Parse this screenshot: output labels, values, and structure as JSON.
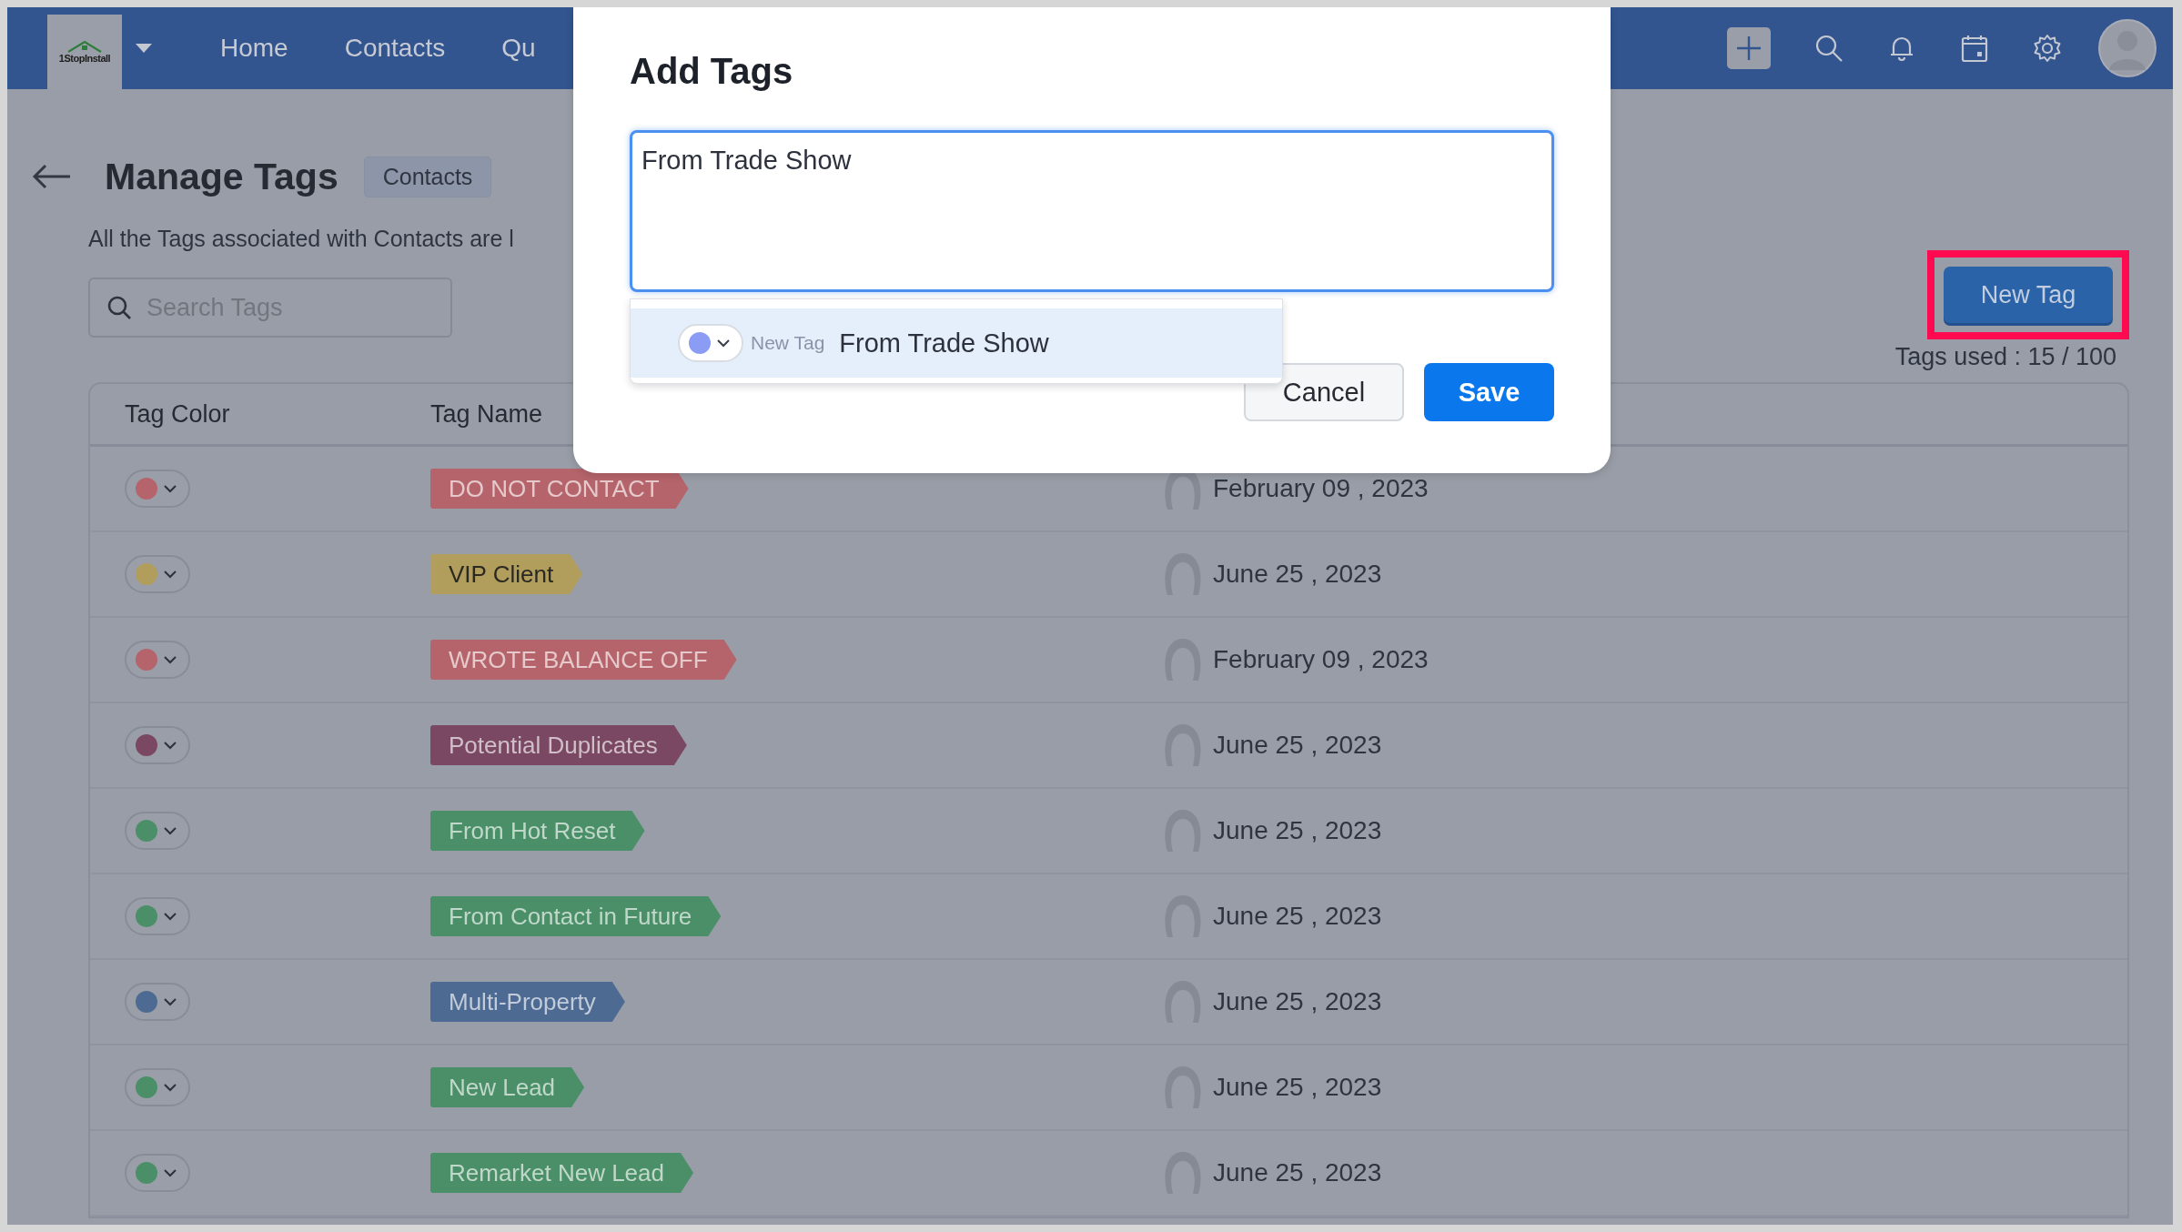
{
  "header": {
    "logo": "1StopInstall",
    "nav": [
      {
        "label": "Home"
      },
      {
        "label": "Contacts"
      },
      {
        "label": "Qu"
      }
    ]
  },
  "page": {
    "title": "Manage Tags",
    "module_badge": "Contacts",
    "description": "All the Tags associated with Contacts are l",
    "search": {
      "placeholder": "Search Tags"
    },
    "new_tag_button": {
      "label": "New Tag",
      "highlighted": true
    },
    "tags_used": "Tags used : 15 / 100"
  },
  "table": {
    "columns": [
      "Tag Color",
      "Tag Name"
    ],
    "rows": [
      {
        "tag": "DO NOT CONTACT",
        "color": "#b5646b",
        "date": "February 09 , 2023"
      },
      {
        "tag": "VIP Client",
        "color": "#b19d5c",
        "date": "June 25 , 2023"
      },
      {
        "tag": "WROTE BALANCE OFF",
        "color": "#b5646b",
        "date": "February 09 , 2023"
      },
      {
        "tag": "Potential Duplicates",
        "color": "#7a4862",
        "date": "June 25 , 2023"
      },
      {
        "tag": "From Hot Reset",
        "color": "#4a8f68",
        "date": "June 25 , 2023"
      },
      {
        "tag": "From Contact in Future",
        "color": "#4a8f68",
        "date": "June 25 , 2023"
      },
      {
        "tag": "Multi-Property",
        "color": "#4d6a92",
        "date": "June 25 , 2023"
      },
      {
        "tag": "New Lead",
        "color": "#4a8f68",
        "date": "June 25 , 2023"
      },
      {
        "tag": "Remarket New Lead",
        "color": "#4a8f68",
        "date": "June 25 , 2023"
      }
    ]
  },
  "dialog": {
    "title": "Add Tags",
    "input_value": "From Trade Show",
    "suggestion": {
      "badge": "New Tag",
      "text": "From Trade Show",
      "color": "#8b9cf5"
    },
    "buttons": [
      {
        "label": "Cancel",
        "kind": "secondary"
      },
      {
        "label": "Save",
        "kind": "primary"
      }
    ]
  }
}
